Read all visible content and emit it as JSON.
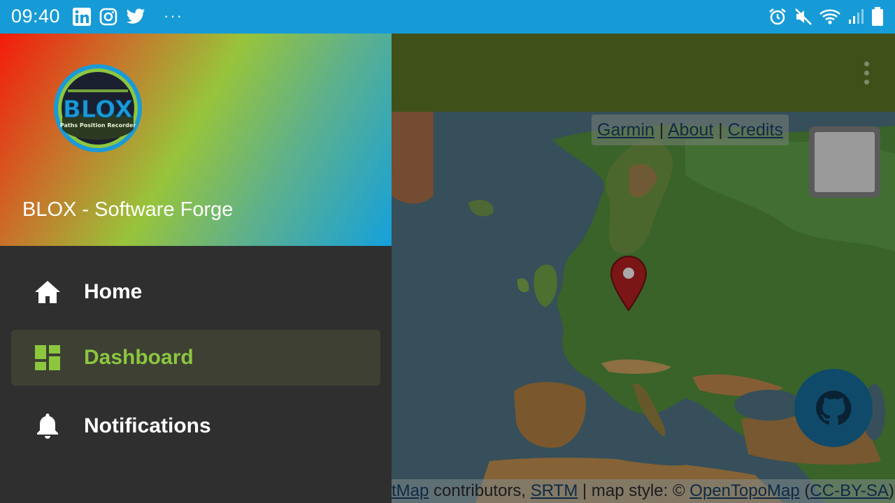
{
  "status_bar": {
    "time": "09:40",
    "left_icons": [
      "linkedin-icon",
      "instagram-icon",
      "twitter-icon",
      "more-notifications-icon"
    ],
    "right_icons": [
      "alarm-icon",
      "mute-icon",
      "wifi-icon",
      "signal-icon",
      "battery-icon"
    ]
  },
  "drawer": {
    "header_title": "BLOX - Software Forge",
    "logo": {
      "text": "BLOX",
      "subtitle": "Paths Position Recorder"
    },
    "items": [
      {
        "label": "Home",
        "icon": "home-icon",
        "active": false
      },
      {
        "label": "Dashboard",
        "icon": "dashboard-icon",
        "active": true
      },
      {
        "label": "Notifications",
        "icon": "bell-icon",
        "active": false
      }
    ]
  },
  "map": {
    "links": {
      "garmin": "Garmin",
      "sep1": "|",
      "about": "About",
      "sep2": "|",
      "credits": "Credits"
    },
    "attribution": {
      "link1": "tMap",
      "text1": " contributors, ",
      "link2": "SRTM",
      "text2": " | map style: © ",
      "link3": "OpenTopoMap",
      "text3": " (",
      "link4": "CC-BY-SA",
      "text4": ")"
    }
  },
  "colors": {
    "status_bar": "#179bd7",
    "app_bar": "#3f5119",
    "drawer_bg": "#2f2f2f",
    "active_item_bg": "#3d4033",
    "accent_green": "#8cc63f",
    "fab": "#0f4a6a",
    "marker": "#8b1a1a"
  }
}
